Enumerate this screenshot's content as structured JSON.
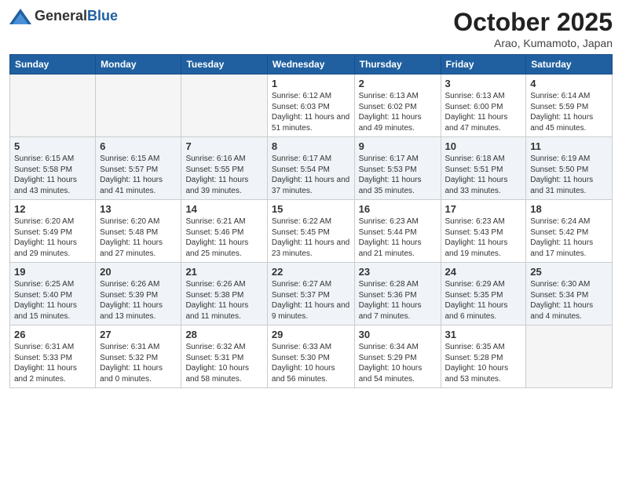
{
  "header": {
    "logo_general": "General",
    "logo_blue": "Blue",
    "month_title": "October 2025",
    "location": "Arao, Kumamoto, Japan"
  },
  "weekdays": [
    "Sunday",
    "Monday",
    "Tuesday",
    "Wednesday",
    "Thursday",
    "Friday",
    "Saturday"
  ],
  "weeks": [
    {
      "days": [
        {
          "num": "",
          "info": ""
        },
        {
          "num": "",
          "info": ""
        },
        {
          "num": "",
          "info": ""
        },
        {
          "num": "1",
          "info": "Sunrise: 6:12 AM\nSunset: 6:03 PM\nDaylight: 11 hours\nand 51 minutes."
        },
        {
          "num": "2",
          "info": "Sunrise: 6:13 AM\nSunset: 6:02 PM\nDaylight: 11 hours\nand 49 minutes."
        },
        {
          "num": "3",
          "info": "Sunrise: 6:13 AM\nSunset: 6:00 PM\nDaylight: 11 hours\nand 47 minutes."
        },
        {
          "num": "4",
          "info": "Sunrise: 6:14 AM\nSunset: 5:59 PM\nDaylight: 11 hours\nand 45 minutes."
        }
      ]
    },
    {
      "days": [
        {
          "num": "5",
          "info": "Sunrise: 6:15 AM\nSunset: 5:58 PM\nDaylight: 11 hours\nand 43 minutes."
        },
        {
          "num": "6",
          "info": "Sunrise: 6:15 AM\nSunset: 5:57 PM\nDaylight: 11 hours\nand 41 minutes."
        },
        {
          "num": "7",
          "info": "Sunrise: 6:16 AM\nSunset: 5:55 PM\nDaylight: 11 hours\nand 39 minutes."
        },
        {
          "num": "8",
          "info": "Sunrise: 6:17 AM\nSunset: 5:54 PM\nDaylight: 11 hours\nand 37 minutes."
        },
        {
          "num": "9",
          "info": "Sunrise: 6:17 AM\nSunset: 5:53 PM\nDaylight: 11 hours\nand 35 minutes."
        },
        {
          "num": "10",
          "info": "Sunrise: 6:18 AM\nSunset: 5:51 PM\nDaylight: 11 hours\nand 33 minutes."
        },
        {
          "num": "11",
          "info": "Sunrise: 6:19 AM\nSunset: 5:50 PM\nDaylight: 11 hours\nand 31 minutes."
        }
      ]
    },
    {
      "days": [
        {
          "num": "12",
          "info": "Sunrise: 6:20 AM\nSunset: 5:49 PM\nDaylight: 11 hours\nand 29 minutes."
        },
        {
          "num": "13",
          "info": "Sunrise: 6:20 AM\nSunset: 5:48 PM\nDaylight: 11 hours\nand 27 minutes."
        },
        {
          "num": "14",
          "info": "Sunrise: 6:21 AM\nSunset: 5:46 PM\nDaylight: 11 hours\nand 25 minutes."
        },
        {
          "num": "15",
          "info": "Sunrise: 6:22 AM\nSunset: 5:45 PM\nDaylight: 11 hours\nand 23 minutes."
        },
        {
          "num": "16",
          "info": "Sunrise: 6:23 AM\nSunset: 5:44 PM\nDaylight: 11 hours\nand 21 minutes."
        },
        {
          "num": "17",
          "info": "Sunrise: 6:23 AM\nSunset: 5:43 PM\nDaylight: 11 hours\nand 19 minutes."
        },
        {
          "num": "18",
          "info": "Sunrise: 6:24 AM\nSunset: 5:42 PM\nDaylight: 11 hours\nand 17 minutes."
        }
      ]
    },
    {
      "days": [
        {
          "num": "19",
          "info": "Sunrise: 6:25 AM\nSunset: 5:40 PM\nDaylight: 11 hours\nand 15 minutes."
        },
        {
          "num": "20",
          "info": "Sunrise: 6:26 AM\nSunset: 5:39 PM\nDaylight: 11 hours\nand 13 minutes."
        },
        {
          "num": "21",
          "info": "Sunrise: 6:26 AM\nSunset: 5:38 PM\nDaylight: 11 hours\nand 11 minutes."
        },
        {
          "num": "22",
          "info": "Sunrise: 6:27 AM\nSunset: 5:37 PM\nDaylight: 11 hours\nand 9 minutes."
        },
        {
          "num": "23",
          "info": "Sunrise: 6:28 AM\nSunset: 5:36 PM\nDaylight: 11 hours\nand 7 minutes."
        },
        {
          "num": "24",
          "info": "Sunrise: 6:29 AM\nSunset: 5:35 PM\nDaylight: 11 hours\nand 6 minutes."
        },
        {
          "num": "25",
          "info": "Sunrise: 6:30 AM\nSunset: 5:34 PM\nDaylight: 11 hours\nand 4 minutes."
        }
      ]
    },
    {
      "days": [
        {
          "num": "26",
          "info": "Sunrise: 6:31 AM\nSunset: 5:33 PM\nDaylight: 11 hours\nand 2 minutes."
        },
        {
          "num": "27",
          "info": "Sunrise: 6:31 AM\nSunset: 5:32 PM\nDaylight: 11 hours\nand 0 minutes."
        },
        {
          "num": "28",
          "info": "Sunrise: 6:32 AM\nSunset: 5:31 PM\nDaylight: 10 hours\nand 58 minutes."
        },
        {
          "num": "29",
          "info": "Sunrise: 6:33 AM\nSunset: 5:30 PM\nDaylight: 10 hours\nand 56 minutes."
        },
        {
          "num": "30",
          "info": "Sunrise: 6:34 AM\nSunset: 5:29 PM\nDaylight: 10 hours\nand 54 minutes."
        },
        {
          "num": "31",
          "info": "Sunrise: 6:35 AM\nSunset: 5:28 PM\nDaylight: 10 hours\nand 53 minutes."
        },
        {
          "num": "",
          "info": ""
        }
      ]
    }
  ]
}
